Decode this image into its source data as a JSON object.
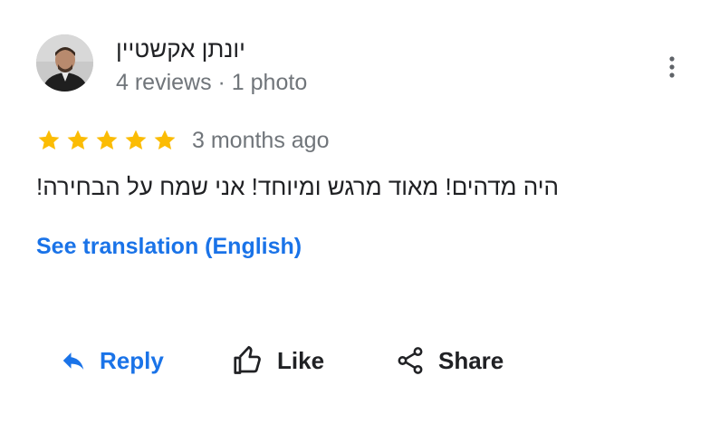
{
  "review": {
    "author": {
      "name": "יונתן אקשטיין",
      "stats": "4 reviews · 1 photo"
    },
    "rating": 5,
    "date": "3 months ago",
    "text": "היה מדהים! מאוד מרגש ומיוחד! אני שמח על הבחירה!",
    "translate_link": "See translation (English)"
  },
  "actions": {
    "reply_label": "Reply",
    "like_label": "Like",
    "share_label": "Share"
  },
  "icons": {
    "menu": "more-vert-icon",
    "star": "star-icon",
    "reply": "reply-arrow-icon",
    "like": "thumb-up-icon",
    "share": "share-icon"
  },
  "colors": {
    "star": "#fbbc04",
    "link": "#1a73e8",
    "secondary_text": "#70757a",
    "primary_text": "#202124"
  }
}
